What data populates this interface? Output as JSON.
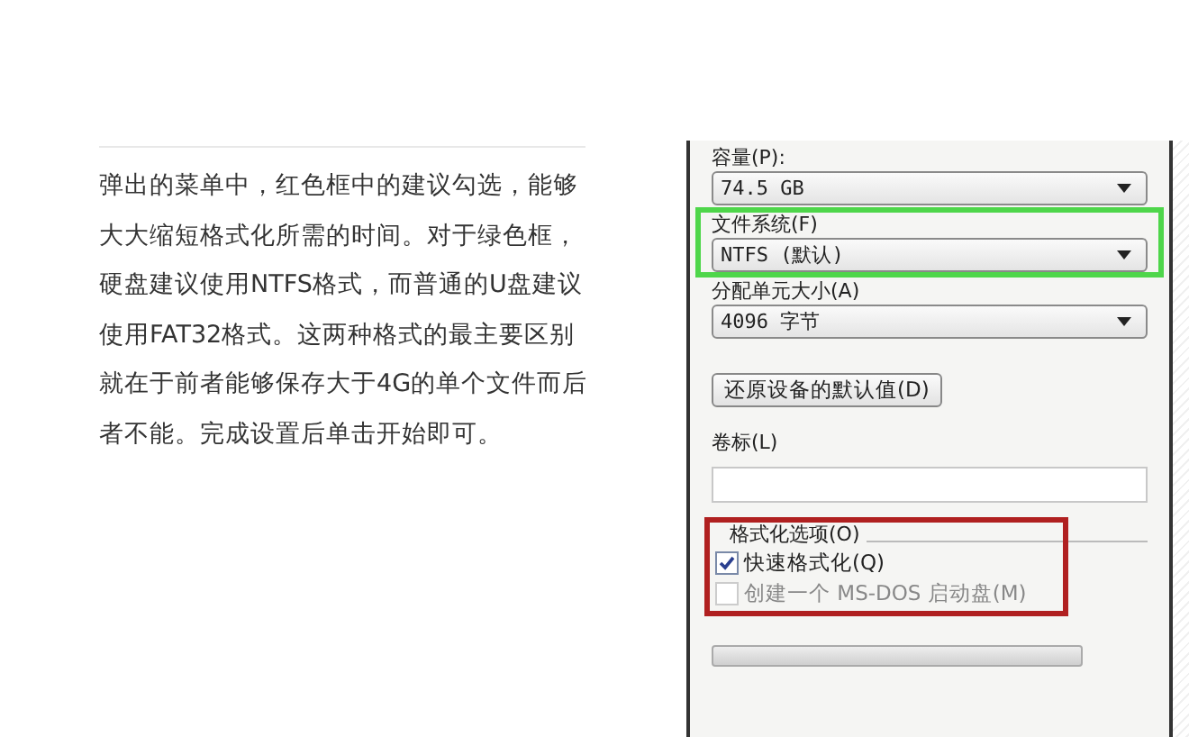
{
  "article": {
    "paragraph": "弹出的菜单中，红色框中的建议勾选，能够大大缩短格式化所需的时间。对于绿色框，硬盘建议使用NTFS格式，而普通的U盘建议使用FAT32格式。这两种格式的最主要区别就在于前者能够保存大于4G的单个文件而后者不能。完成设置后单击开始即可。"
  },
  "dialog": {
    "fields": [
      {
        "kind": "dropdown",
        "label": "容量(P):",
        "value": "74.5 GB",
        "highlighted": false
      },
      {
        "kind": "dropdown",
        "label": "文件系统(F)",
        "value": "NTFS (默认)",
        "highlighted": true,
        "color": "#4ed64a"
      },
      {
        "kind": "dropdown",
        "label": "分配单元大小(A)",
        "value": "4096 字节",
        "highlighted": false
      }
    ],
    "restore_button": "还原设备的默认值(D)",
    "volume_label": {
      "label": "卷标(L)"
    },
    "format_options": {
      "title": "格式化选项(O)",
      "highlighted": true,
      "color": "#b02020",
      "options": [
        {
          "label": "快速格式化(Q)",
          "checked": true,
          "disabled": false
        },
        {
          "label": "创建一个 MS-DOS 启动盘(M)",
          "checked": false,
          "disabled": true
        }
      ]
    },
    "progress": {
      "level": 0
    }
  }
}
